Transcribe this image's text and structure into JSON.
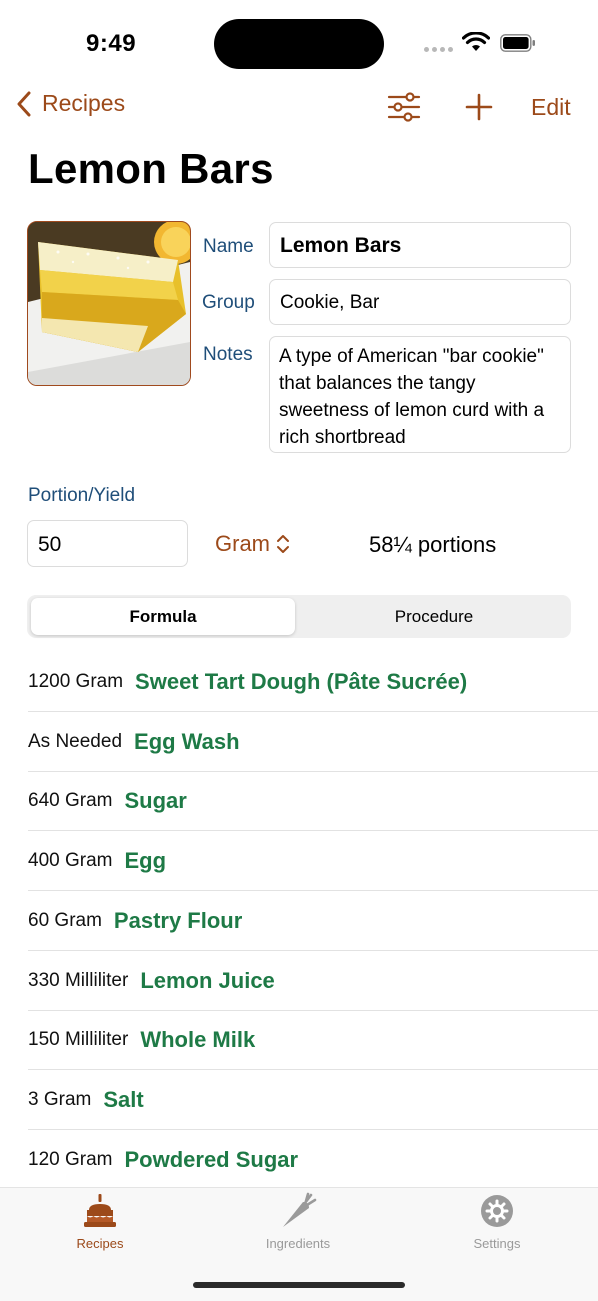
{
  "status_bar": {
    "time": "9:49"
  },
  "nav": {
    "back_label": "Recipes",
    "edit_label": "Edit",
    "accent_color": "#9c4a1a"
  },
  "recipe": {
    "title": "Lemon Bars",
    "fields": {
      "name_label": "Name",
      "name_value": "Lemon Bars",
      "group_label": "Group",
      "group_value": "Cookie, Bar",
      "notes_label": "Notes",
      "notes_value": "A type of American \"bar cookie\" that balances the tangy sweetness of lemon curd with a rich shortbread"
    },
    "portion": {
      "label": "Portion/Yield",
      "value": "50",
      "unit": "Gram",
      "portions_text": "58¼ portions"
    }
  },
  "segments": {
    "formula": "Formula",
    "procedure": "Procedure",
    "selected": "Formula"
  },
  "ingredients": [
    {
      "qty": "1200 Gram",
      "name": "Sweet Tart Dough (Pâte Sucrée)"
    },
    {
      "qty": "As Needed",
      "name": "Egg Wash"
    },
    {
      "qty": "640 Gram",
      "name": "Sugar"
    },
    {
      "qty": "400 Gram",
      "name": "Egg"
    },
    {
      "qty": "60 Gram",
      "name": "Pastry Flour"
    },
    {
      "qty": "330 Milliliter",
      "name": "Lemon Juice"
    },
    {
      "qty": "150 Milliliter",
      "name": "Whole Milk"
    },
    {
      "qty": "3 Gram",
      "name": "Salt"
    },
    {
      "qty": "120 Gram",
      "name": "Powdered Sugar"
    }
  ],
  "tabbar": {
    "recipes": "Recipes",
    "ingredients": "Ingredients",
    "settings": "Settings",
    "active": "Recipes"
  },
  "colors": {
    "accent": "#9c4a1a",
    "ingredient_name": "#1e7a46",
    "field_label": "#1f4e79"
  }
}
